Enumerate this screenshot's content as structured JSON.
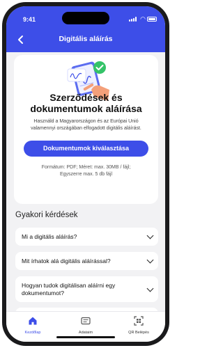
{
  "status": {
    "time": "9:41"
  },
  "header": {
    "title": "Digitális aláírás"
  },
  "card": {
    "heading": "Szerződések és dokumentumok aláírása",
    "description": "Használd a Magyarországon és az Európai Unió valamennyi országában elfogadott digitális aláírást.",
    "button_label": "Dokumentumok kiválasztása",
    "format_line1": "Formátum: PDF; Méret: max. 30MB / fájl;",
    "format_line2": "Egyszerre max. 5 db fájl"
  },
  "faq": {
    "title": "Gyakori kérdések",
    "items": [
      {
        "question": "Mi a digitális aláírás?"
      },
      {
        "question": "Mit írhatok alá digitális aláírással?"
      },
      {
        "question": "Hogyan tudok digitálisan aláírni egy dokumentumot?"
      }
    ]
  },
  "tabbar": {
    "tabs": [
      {
        "label": "Kezdőlap",
        "icon": "home-icon",
        "active": true
      },
      {
        "label": "Adataim",
        "icon": "id-card-icon",
        "active": false
      },
      {
        "label": "QR Belépés",
        "icon": "qr-scan-icon",
        "active": false
      }
    ]
  },
  "colors": {
    "primary": "#3d4ee8",
    "background": "#f2f2f4",
    "success": "#34c368",
    "hand": "#f4a07a"
  }
}
